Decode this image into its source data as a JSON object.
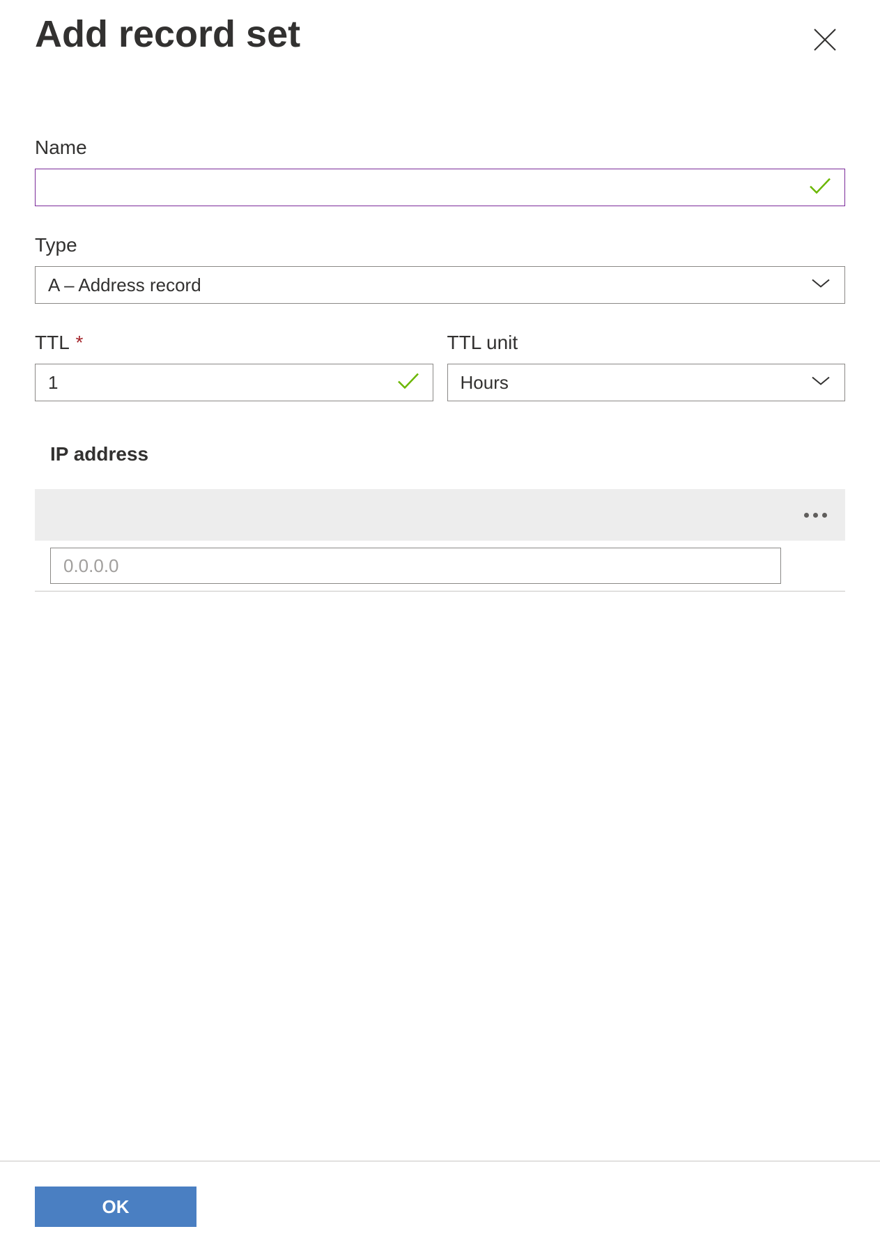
{
  "header": {
    "title": "Add record set"
  },
  "fields": {
    "name": {
      "label": "Name",
      "value": ""
    },
    "type": {
      "label": "Type",
      "selected": "A – Address record"
    },
    "ttl": {
      "label": "TTL",
      "value": "1"
    },
    "ttl_unit": {
      "label": "TTL unit",
      "selected": "Hours"
    },
    "ip_address": {
      "header": "IP address",
      "placeholder": "0.0.0.0"
    }
  },
  "footer": {
    "ok_label": "OK"
  }
}
